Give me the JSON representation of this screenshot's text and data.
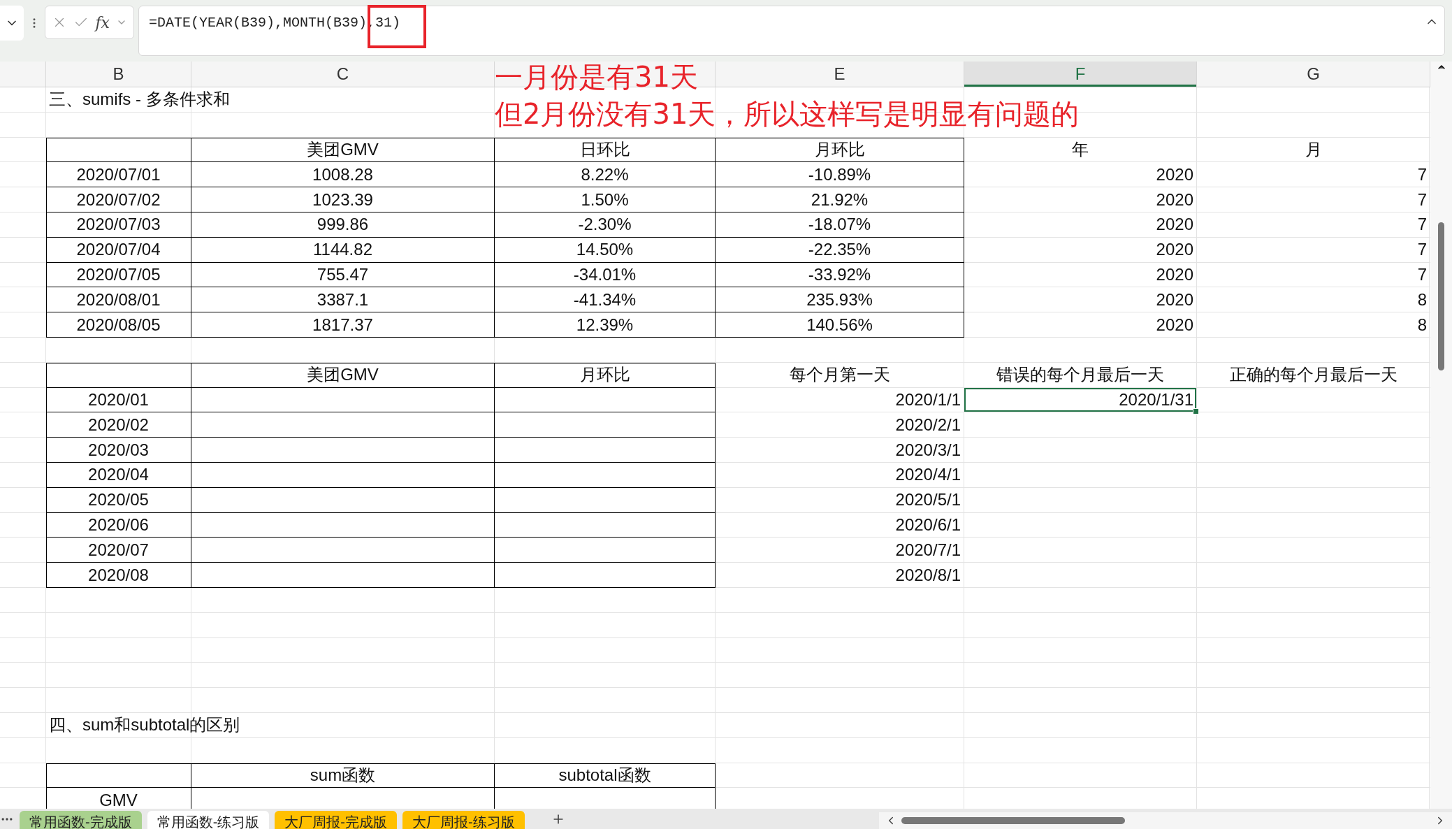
{
  "formula_bar": {
    "formula": "=DATE(YEAR(B39),MONTH(B39),31)",
    "fx_label": "fx"
  },
  "annotation": {
    "lines": [
      "一月份是有31天",
      "但2月份没有31天，所以这样写是明显有问题的"
    ]
  },
  "column_headers": [
    {
      "label": "B",
      "selected": false
    },
    {
      "label": "C",
      "selected": false
    },
    {
      "label": "E",
      "selected": false
    },
    {
      "label": "F",
      "selected": true
    },
    {
      "label": "G",
      "selected": false
    }
  ],
  "section_1": {
    "title": "三、sumifs - 多条件求和",
    "headers": [
      "美团GMV",
      "日环比",
      "月环比",
      "年",
      "月"
    ],
    "rows": [
      [
        "2020/07/01",
        "1008.28",
        "8.22%",
        "-10.89%",
        "2020",
        "7"
      ],
      [
        "2020/07/02",
        "1023.39",
        "1.50%",
        "21.92%",
        "2020",
        "7"
      ],
      [
        "2020/07/03",
        "999.86",
        "-2.30%",
        "-18.07%",
        "2020",
        "7"
      ],
      [
        "2020/07/04",
        "1144.82",
        "14.50%",
        "-22.35%",
        "2020",
        "7"
      ],
      [
        "2020/07/05",
        "755.47",
        "-34.01%",
        "-33.92%",
        "2020",
        "7"
      ],
      [
        "2020/08/01",
        "3387.1",
        "-41.34%",
        "235.93%",
        "2020",
        "8"
      ],
      [
        "2020/08/05",
        "1817.37",
        "12.39%",
        "140.56%",
        "2020",
        "8"
      ]
    ]
  },
  "section_2": {
    "headers": [
      "美团GMV",
      "月环比",
      "每个月第一天",
      "错误的每个月最后一天",
      "正确的每个月最后一天"
    ],
    "rows": [
      {
        "month": "2020/01",
        "first_day": "2020/1/1",
        "wrong_last_day": "2020/1/31",
        "selected": true
      },
      {
        "month": "2020/02",
        "first_day": "2020/2/1",
        "selected": false
      },
      {
        "month": "2020/03",
        "first_day": "2020/3/1",
        "selected": false
      },
      {
        "month": "2020/04",
        "first_day": "2020/4/1",
        "selected": false
      },
      {
        "month": "2020/05",
        "first_day": "2020/5/1",
        "selected": false
      },
      {
        "month": "2020/06",
        "first_day": "2020/6/1",
        "selected": false
      },
      {
        "month": "2020/07",
        "first_day": "2020/7/1",
        "selected": false
      },
      {
        "month": "2020/08",
        "first_day": "2020/8/1",
        "selected": false
      }
    ]
  },
  "section_3": {
    "title": "四、sum和subtotal的区别",
    "headers": [
      "sum函数",
      "subtotal函数"
    ],
    "rows": [
      [
        "GMV"
      ]
    ]
  },
  "sheet_tabs": [
    {
      "label": "常用函数-完成版",
      "color": "#a9d18e",
      "selected": false
    },
    {
      "label": "常用函数-练习版",
      "selected": true
    },
    {
      "label": "大厂周报-完成版",
      "color": "#ffc000",
      "selected": false
    },
    {
      "label": "大厂周报-练习版",
      "color": "#ffc000",
      "selected": false
    }
  ]
}
